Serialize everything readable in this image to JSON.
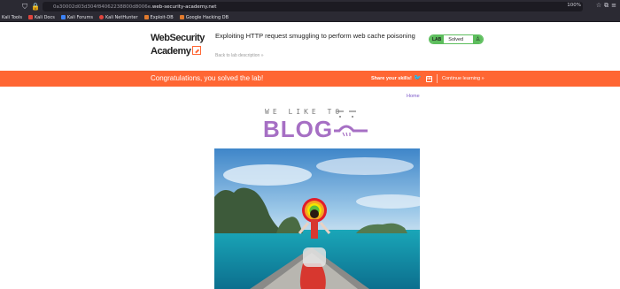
{
  "browser": {
    "url_host": "0a30002d03d304f84062238800d8006e",
    "url_domain": ".web-security-academy.net",
    "zoom": "100%",
    "bookmarks": [
      {
        "label": "Kali Tools",
        "color": "#ffffff"
      },
      {
        "label": "Kali Docs",
        "color": "#e0453d"
      },
      {
        "label": "Kali Forums",
        "color": "#3b82f6"
      },
      {
        "label": "Kali NetHunter",
        "color": "#e0453d"
      },
      {
        "label": "Exploit-DB",
        "color": "#e07a2d"
      },
      {
        "label": "Google Hacking DB",
        "color": "#e07a2d"
      }
    ]
  },
  "lab": {
    "logo_line1": "WebSecurity",
    "logo_line2": "Academy",
    "title": "Exploiting HTTP request smuggling to perform web cache poisoning",
    "back_link": "Back to lab description",
    "back_arrow": "»",
    "status_badge": "LAB",
    "status_text": "Solved",
    "status_icon": "♙"
  },
  "banner": {
    "message": "Congratulations, you solved the lab!",
    "share_label": "Share your skills!",
    "twitter_glyph": "🐦",
    "linkedin_glyph": "in",
    "continue_label": "Continue learning »",
    "bg_color": "#ff6633"
  },
  "blog": {
    "home_link": "Home",
    "logo_sub": "WE LIKE TO",
    "logo_word": "BLOG",
    "accent_color": "#a66fc4"
  }
}
